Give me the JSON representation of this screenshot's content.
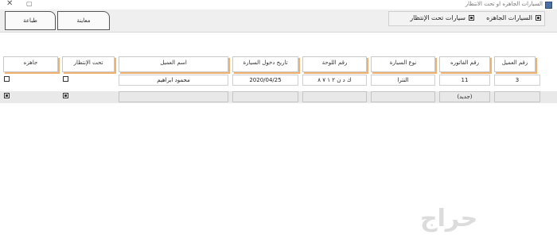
{
  "window": {
    "title": "السيارات الجاهزه او تحت الانتظار",
    "close_glyph": "✕",
    "restore_glyph": "▢"
  },
  "toolbar": {
    "print_label": "طباعة",
    "preview_label": "معاينة"
  },
  "filters": {
    "ready_label": "السيارات الجاهزه",
    "waiting_label": "سيارات تحت الإنتظار"
  },
  "grid": {
    "headers": [
      "رقم العميل",
      "رقم الفاتوره",
      "نوع السيارة",
      "رقم اللوحة",
      "تاريخ دخول السيارة",
      "اسم العميل",
      "تحت الإنتظار",
      "جاهزه"
    ],
    "rows": [
      {
        "customer_no": "3",
        "invoice_no": "11",
        "car_type": "النترا",
        "plate_no": "ك د ن ٢ ١ ٧ ٨",
        "entry_date": "2020/04/25",
        "customer_name": "محمود ابراهيم"
      }
    ],
    "new_row_label": "(جديد)"
  },
  "watermark": "حراج"
}
